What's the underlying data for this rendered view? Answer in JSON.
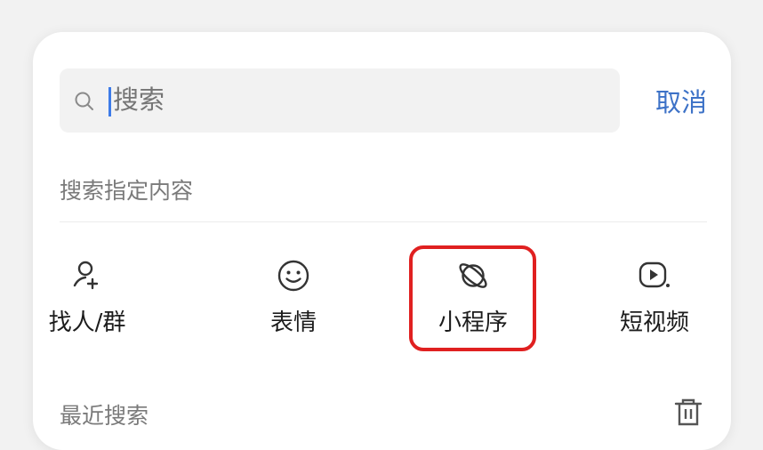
{
  "search": {
    "placeholder": "搜索",
    "value": "",
    "cancel_label": "取消"
  },
  "specify": {
    "title": "搜索指定内容",
    "options": [
      {
        "label": "找人/群",
        "icon": "add-person-icon"
      },
      {
        "label": "表情",
        "icon": "smiley-icon"
      },
      {
        "label": "小程序",
        "icon": "mini-program-icon"
      },
      {
        "label": "短视频",
        "icon": "video-icon"
      }
    ],
    "highlighted_option": "小程序"
  },
  "recent": {
    "title": "最近搜索",
    "clear_icon": "trash-icon"
  },
  "colors": {
    "accent": "#3d72c7",
    "highlight_border": "#e02020",
    "search_bg": "#f2f2f2",
    "muted_text": "#7a7a7a"
  }
}
